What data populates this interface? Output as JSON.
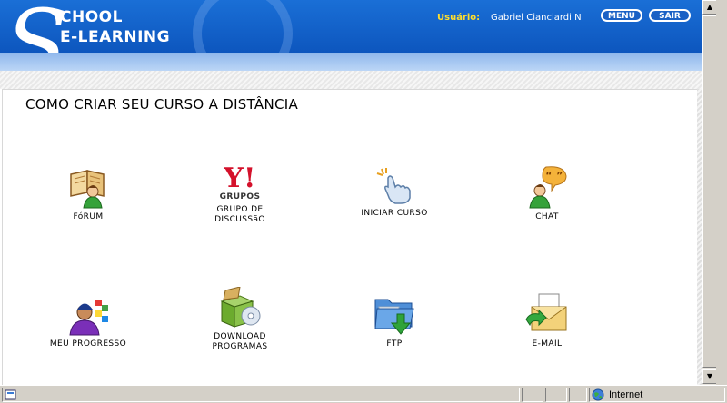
{
  "header": {
    "logo_letter": "S",
    "logo_line1": "CHOOL",
    "logo_line2": "E-LEARNING",
    "user_label": "Usuário:",
    "user_name": "Gabriel Cianciardi N",
    "menu_button": "MENU",
    "sair_button": "SAIR"
  },
  "main": {
    "title": "COMO CRIAR SEU CURSO A DISTÂNCIA",
    "tiles": [
      {
        "label": "FóRUM",
        "icon": "forum-icon"
      },
      {
        "label": "GRUPO DE\nDISCUSSãO",
        "icon": "yahoo-groups-icon",
        "icon_text": "Y!",
        "icon_sub": "GRUPOS"
      },
      {
        "label": "INICIAR CURSO",
        "icon": "hand-click-icon"
      },
      {
        "label": "CHAT",
        "icon": "chat-icon"
      },
      {
        "label": "MEU PROGRESSO",
        "icon": "progress-icon"
      },
      {
        "label": "DOWNLOAD\nPROGRAMAS",
        "icon": "download-box-icon"
      },
      {
        "label": "FTP",
        "icon": "ftp-folder-icon"
      },
      {
        "label": "E-MAIL",
        "icon": "email-icon"
      }
    ]
  },
  "statusbar": {
    "zone": "Internet"
  }
}
